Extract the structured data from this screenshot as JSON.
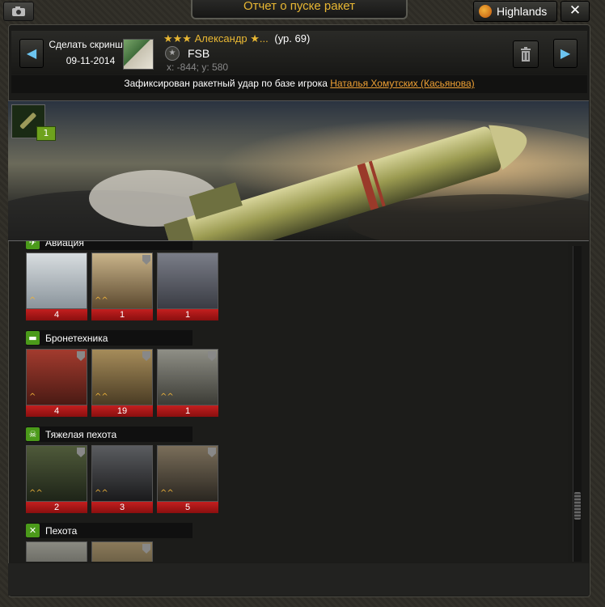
{
  "window": {
    "title": "Отчет о пуске ракет",
    "server": "Highlands",
    "close": "✕"
  },
  "header": {
    "screenshot_label": "Сделать скриншот",
    "date": "09-11-2014",
    "player_stars": "★★★",
    "player_name": "Александр ★...",
    "player_level": "(ур. 69)",
    "clan": "FSB",
    "coords": "x: -844; y: 580"
  },
  "message": {
    "text": "Зафиксирован ракетный удар по базе игрока ",
    "target": "Наталья Хомутских (Касьянова)"
  },
  "banner": {
    "missile_count": "1"
  },
  "categories": [
    {
      "label": "Авиация",
      "counts": [
        "4",
        "1",
        "1"
      ]
    },
    {
      "label": "Бронетехника",
      "counts": [
        "4",
        "19",
        "1"
      ]
    },
    {
      "label": "Тяжелая пехота",
      "counts": [
        "2",
        "3",
        "5"
      ]
    },
    {
      "label": "Пехота",
      "counts": [
        "",
        ""
      ]
    }
  ],
  "colors": {
    "accent": "#e8b733",
    "link": "#f0a134",
    "count_bar": "#c31f1f",
    "category_icon": "#4b9a1a"
  }
}
